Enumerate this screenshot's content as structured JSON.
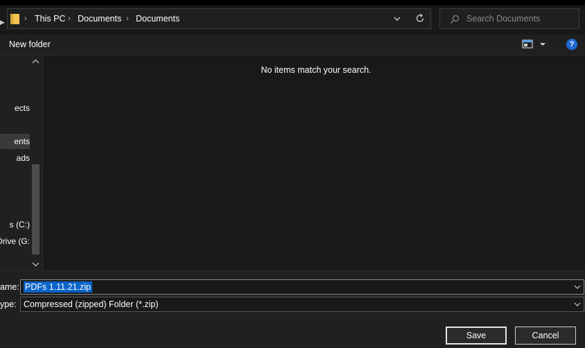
{
  "breadcrumb": [
    "This PC",
    "Documents",
    "Documents"
  ],
  "search": {
    "placeholder": "Search Documents"
  },
  "toolbar": {
    "new_folder_label": "New folder",
    "help_label": "?"
  },
  "nav": {
    "items": [
      {
        "label": "ects",
        "selected": false
      },
      {
        "label": "ents",
        "selected": true
      },
      {
        "label": "ads",
        "selected": false
      },
      {
        "label": "s (C:)",
        "selected": false
      },
      {
        "label": "Drive (G:",
        "selected": false
      }
    ]
  },
  "content": {
    "empty_message": "No items match your search."
  },
  "form": {
    "filename_label": "ame:",
    "filename_value": "PDFs 1.11.21.zip",
    "filetype_label": "ype:",
    "filetype_value": "Compressed (zipped) Folder (*.zip)"
  },
  "buttons": {
    "save": "Save",
    "cancel": "Cancel"
  },
  "colors": {
    "accent": "#0a64c8",
    "help": "#1e6ad6",
    "folder": "#f3c451"
  }
}
